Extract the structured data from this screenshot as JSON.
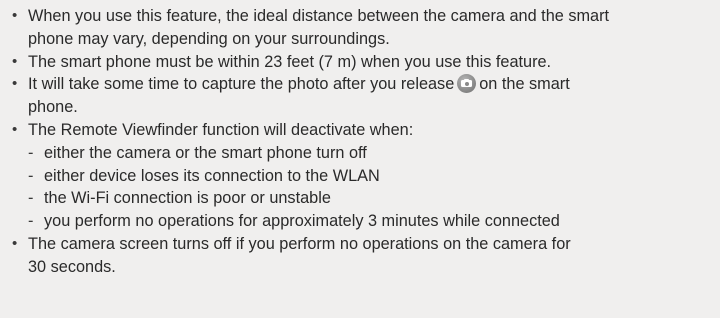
{
  "notes": {
    "bullet_symbol": "•",
    "dash_symbol": "-",
    "item1": {
      "line1": "When you use this feature, the ideal distance between the camera and the smart",
      "line2": "phone may vary, depending on your surroundings."
    },
    "item2": {
      "line1": "The smart phone must be within 23 feet (7 m) when you use this feature."
    },
    "item3": {
      "line1_before_icon": "It will take some time to capture the photo after you release",
      "icon": "camera-shutter-icon",
      "line1_after_icon": "on the smart",
      "line2": "phone."
    },
    "item4": {
      "line1": "The Remote Viewfinder function will deactivate when:",
      "subitems": [
        "either the camera or the smart phone turn off",
        "either device loses its connection to the WLAN",
        "the Wi-Fi connection is poor or unstable",
        "you perform no operations for approximately 3 minutes while connected"
      ]
    },
    "item5": {
      "line1": "The camera screen turns off if you perform no operations on the camera for",
      "line2": "30 seconds."
    }
  },
  "colors": {
    "background": "#f0efee",
    "text": "#2a2a2a",
    "icon": "#8a8a8a"
  }
}
